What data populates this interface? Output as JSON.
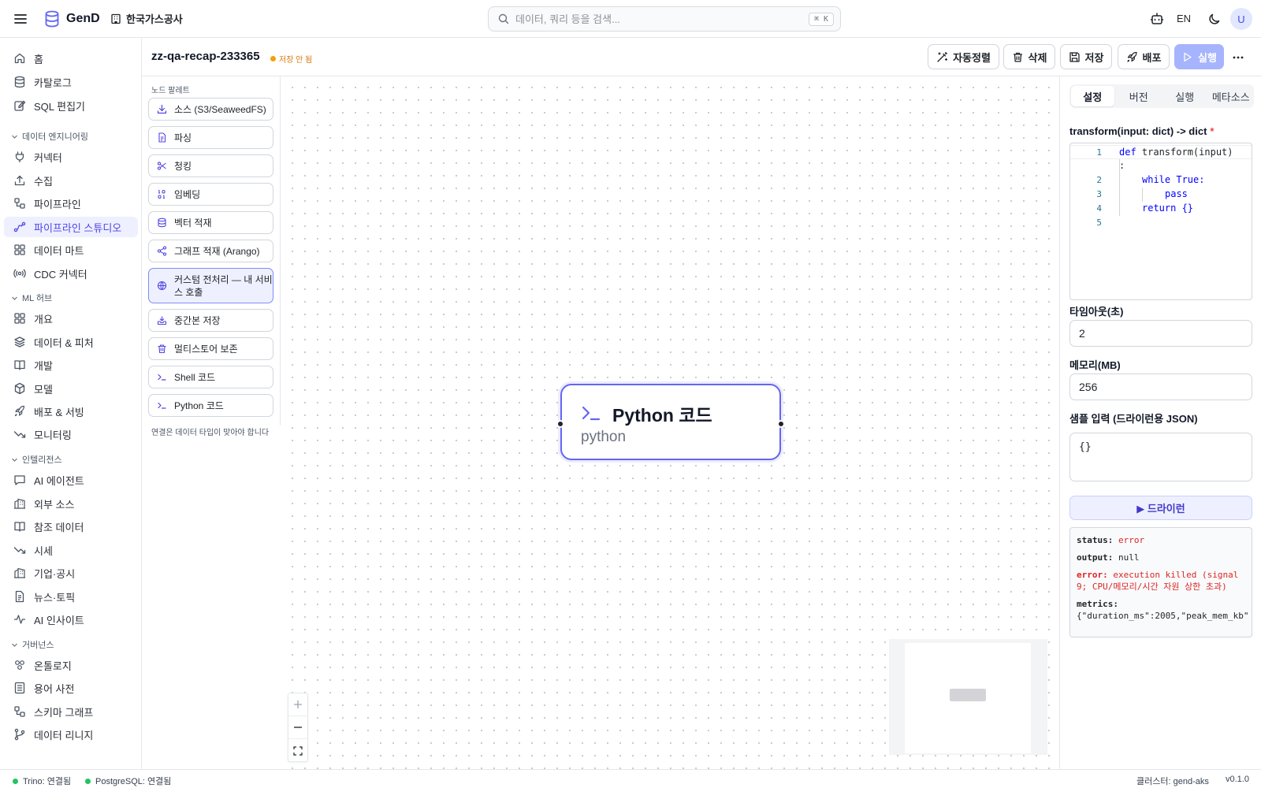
{
  "topbar": {
    "brand": "GenD",
    "org": "한국가스공사",
    "search_placeholder": "데이터, 쿼리 등을 검색...",
    "search_shortcut": "⌘ K",
    "lang": "EN",
    "avatar": "U"
  },
  "sidebar": {
    "items_top": [
      {
        "label": "홈",
        "icon": "home-icon"
      },
      {
        "label": "카탈로그",
        "icon": "database-icon"
      },
      {
        "label": "SQL 편집기",
        "icon": "edit-icon"
      }
    ],
    "groups": [
      {
        "label": "데이터 엔지니어링",
        "items": [
          {
            "label": "커넥터",
            "icon": "plug-icon"
          },
          {
            "label": "수집",
            "icon": "upload-icon"
          },
          {
            "label": "파이프라인",
            "icon": "workflow-icon"
          },
          {
            "label": "파이프라인 스튜디오",
            "icon": "route-icon",
            "active": true
          },
          {
            "label": "데이터 마트",
            "icon": "grid-icon"
          },
          {
            "label": "CDC 커넥터",
            "icon": "radio-icon"
          }
        ]
      },
      {
        "label": "ML 허브",
        "items": [
          {
            "label": "개요",
            "icon": "grid-icon"
          },
          {
            "label": "데이터 & 피처",
            "icon": "layers-icon"
          },
          {
            "label": "개발",
            "icon": "book-icon"
          },
          {
            "label": "모델",
            "icon": "box-icon"
          },
          {
            "label": "배포 & 서빙",
            "icon": "rocket-icon"
          },
          {
            "label": "모니터링",
            "icon": "trend-icon"
          }
        ]
      },
      {
        "label": "인텔리전스",
        "items": [
          {
            "label": "AI 에이전트",
            "icon": "chat-icon"
          },
          {
            "label": "외부 소스",
            "icon": "building-icon"
          },
          {
            "label": "참조 데이터",
            "icon": "book-icon"
          },
          {
            "label": "시세",
            "icon": "trend-icon"
          },
          {
            "label": "기업·공시",
            "icon": "building-icon"
          },
          {
            "label": "뉴스·토픽",
            "icon": "file-icon"
          },
          {
            "label": "AI 인사이트",
            "icon": "activity-icon"
          }
        ]
      },
      {
        "label": "거버넌스",
        "items": [
          {
            "label": "온톨로지",
            "icon": "atom-icon"
          },
          {
            "label": "용어 사전",
            "icon": "list-icon"
          },
          {
            "label": "스키마 그래프",
            "icon": "workflow-icon"
          },
          {
            "label": "데이터 리니지",
            "icon": "branch-icon"
          }
        ]
      }
    ]
  },
  "header": {
    "title": "zz-qa-recap-233365",
    "unsaved": "저장 안 됨",
    "buttons": {
      "autolayout": "자동정렬",
      "delete": "삭제",
      "save": "저장",
      "deploy": "배포",
      "run": "실행"
    }
  },
  "palette": {
    "title": "노드 팔레트",
    "items": [
      {
        "label": "소스 (S3/SeaweedFS)",
        "icon": "download-icon"
      },
      {
        "label": "파싱",
        "icon": "file-icon"
      },
      {
        "label": "청킹",
        "icon": "scissors-icon"
      },
      {
        "label": "임베딩",
        "icon": "binary-icon"
      },
      {
        "label": "벡터 적재",
        "icon": "database-icon"
      },
      {
        "label": "그래프 적재 (Arango)",
        "icon": "share-icon"
      },
      {
        "label": "커스텀 전처리 — 내 서비스 호출",
        "icon": "globe-icon",
        "selected": true
      },
      {
        "label": "중간본 저장",
        "icon": "save-down-icon"
      },
      {
        "label": "멀티스토어 보존",
        "icon": "trash-icon"
      },
      {
        "label": "Shell 코드",
        "icon": "terminal-icon"
      },
      {
        "label": "Python 코드",
        "icon": "terminal-icon"
      }
    ],
    "footer": "연결은 데이터 타입이 맞아야 합니다"
  },
  "node": {
    "title": "Python 코드",
    "type": "python"
  },
  "panel": {
    "tabs": [
      "설정",
      "버전",
      "실행",
      "메타소스"
    ],
    "active_tab": "설정",
    "code_label": "transform(input: dict) -> dict",
    "required_mark": "*",
    "code_lines": [
      {
        "n": "1",
        "indent": 0,
        "kw": "def",
        "rest": " transform(input)"
      },
      {
        "n": "",
        "indent": 0,
        "kw": "",
        "rest": ":"
      },
      {
        "n": "2",
        "indent": 1,
        "kw": "while",
        "rest": " True:"
      },
      {
        "n": "3",
        "indent": 2,
        "kw": "",
        "rest": "pass"
      },
      {
        "n": "4",
        "indent": 1,
        "kw": "return",
        "rest": " {}"
      },
      {
        "n": "5",
        "indent": 0,
        "kw": "",
        "rest": ""
      }
    ],
    "timeout_label": "타임아웃(초)",
    "timeout_value": "2",
    "memory_label": "메모리(MB)",
    "memory_value": "256",
    "sample_label": "샘플 입력 (드라이런용 JSON)",
    "sample_value": "{}",
    "dryrun_label": "▶ 드라이런",
    "result": {
      "status_key": "status:",
      "status_val": "error",
      "output_key": "output:",
      "output_val": "null",
      "error_key": "error:",
      "error_val": "execution killed (signal 9; CPU/메모리/시간 자원 상한 초과)",
      "metrics_key": "metrics:",
      "metrics_val": "{\"duration_ms\":2005,\"peak_mem_kb\""
    }
  },
  "footer": {
    "trino": "Trino: 연결됨",
    "postgres": "PostgreSQL: 연결됨",
    "cluster": "클러스터: gend-aks",
    "version": "v0.1.0"
  },
  "colors": {
    "accent": "#6366f1",
    "active_bg": "#eef0ff",
    "warning": "#f59e0b",
    "error": "#dc2626",
    "ok": "#22c55e"
  }
}
